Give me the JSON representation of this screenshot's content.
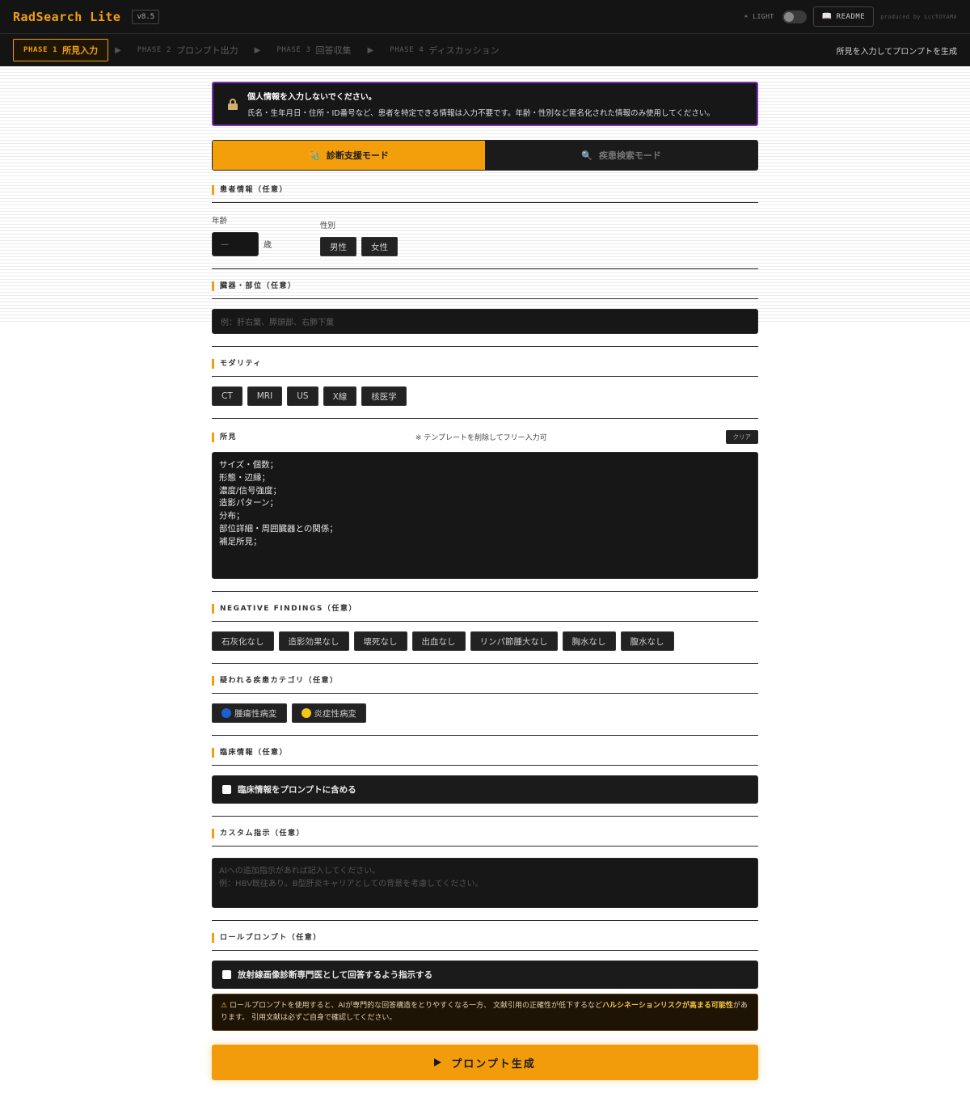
{
  "app": {
    "title": "RadSearch Lite",
    "version": "v8.5",
    "theme_label": "☀ LIGHT",
    "readme_label": "README",
    "credit": "produced by LccTOYAMA"
  },
  "phases": [
    {
      "num": "PHASE 1",
      "label": "所見入力"
    },
    {
      "num": "PHASE 2",
      "label": "プロンプト出力"
    },
    {
      "num": "PHASE 3",
      "label": "回答収集"
    },
    {
      "num": "PHASE 4",
      "label": "ディスカッション"
    }
  ],
  "phase_hint": "所見を入力してプロンプトを生成",
  "notice": {
    "title": "個人情報を入力しないでください。",
    "body": "氏名・生年月日・住所・ID番号など、患者を特定できる情報は入力不要です。年齢・性別など匿名化された情報のみ使用してください。"
  },
  "modes": [
    {
      "icon": "🩺",
      "label": "診断支援モード"
    },
    {
      "icon": "🔍",
      "label": "疾患検索モード"
    }
  ],
  "patient": {
    "section": "患者情報（任意）",
    "age_label": "年齢",
    "age_placeholder": "—",
    "age_unit": "歳",
    "sex_label": "性別",
    "sex_options": [
      "男性",
      "女性"
    ]
  },
  "organ": {
    "section": "臓器・部位（任意）",
    "placeholder": "例：肝右葉、膵頭部、右肺下葉"
  },
  "modality": {
    "section": "モダリティ",
    "options": [
      "CT",
      "MRI",
      "US",
      "X線",
      "核医学"
    ]
  },
  "findings": {
    "section": "所見",
    "hint": "※ テンプレートを削除してフリー入力可",
    "clear_label": "クリア",
    "template": "サイズ・個数；\n形態・辺縁；\n濃度/信号強度；\n造影パターン；\n分布；\n部位詳細・周囲臓器との関係；\n補足所見；"
  },
  "negative": {
    "section": "NEGATIVE FINDINGS（任意）",
    "options": [
      "石灰化なし",
      "造影効果なし",
      "壊死なし",
      "出血なし",
      "リンパ節腫大なし",
      "胸水なし",
      "腹水なし"
    ]
  },
  "category": {
    "section": "疑われる疾患カテゴリ（任意）",
    "options": [
      "腫瘍性病変",
      "炎症性病変"
    ]
  },
  "clinical": {
    "section": "臨床情報（任意）",
    "checkbox_label": "臨床情報をプロンプトに含める"
  },
  "custom": {
    "section": "カスタム指示（任意）",
    "placeholder": "AIへの追加指示があれば記入してください。\n例：HBV既往あり。B型肝炎キャリアとしての背景を考慮してください。"
  },
  "role": {
    "section": "ロールプロンプト（任意）",
    "checkbox_label": "放射線画像診断専門医として回答するよう指示する",
    "warning_pre": "ロールプロンプトを使用すると、AIが専門的な回答構造をとりやすくなる一方、 文献引用の正確性が低下するなど",
    "warning_bold": "ハルシネーションリスクが高まる可能性",
    "warning_post": "があります。 引用文献は必ずご自身で確認してください。"
  },
  "generate_label": "プロンプト生成",
  "colors": {
    "accent": "#f29f0b",
    "notice_border": "#7b2fbf",
    "tumor": "#1f5fd1",
    "inflammation": "#f5c518"
  }
}
